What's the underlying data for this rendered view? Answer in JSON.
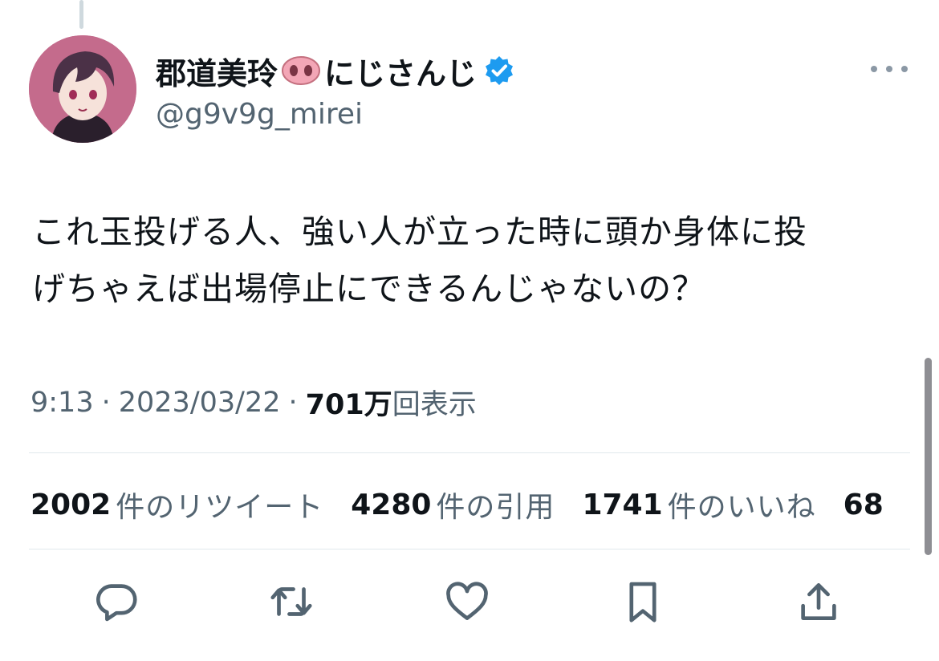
{
  "tweet": {
    "display_name": "郡道美玲",
    "name_suffix": "にじさんじ",
    "handle": "@g9v9g_mirei",
    "emoji_icon": "pig-nose-icon",
    "verified_icon": "verified-badge-icon",
    "verified_color": "#1d9bf0",
    "text_lines": [
      "これ玉投げる人、強い人が立った時に頭か身体に投",
      "げちゃえば出場停止にできるんじゃないの？"
    ],
    "time": "9:13",
    "separator": "·",
    "date": "2023/03/22",
    "views_count": "701万",
    "views_label": "回表示"
  },
  "stats": [
    {
      "count": "2002",
      "label": "件のリツイート"
    },
    {
      "count": "4280",
      "label": "件の引用"
    },
    {
      "count": "1741",
      "label": "件のいいね"
    },
    {
      "count": "68",
      "label": ""
    }
  ],
  "actions": [
    "reply-icon",
    "retweet-icon",
    "like-icon",
    "bookmark-icon",
    "share-icon"
  ],
  "colors": {
    "text": "#0f1419",
    "secondary": "#536471",
    "divider": "#e1e8ed",
    "icon": "#536471"
  }
}
